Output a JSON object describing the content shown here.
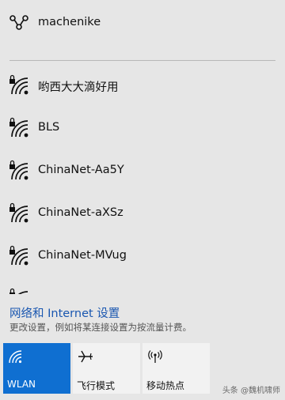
{
  "current": {
    "name": "machenike",
    "icon": "hotspot-link-icon"
  },
  "networks": [
    {
      "name": "哟西大大滴好用",
      "icon": "wifi-secured-icon"
    },
    {
      "name": "BLS",
      "icon": "wifi-secured-icon"
    },
    {
      "name": "ChinaNet-Aa5Y",
      "icon": "wifi-secured-icon"
    },
    {
      "name": "ChinaNet-aXSz",
      "icon": "wifi-secured-icon"
    },
    {
      "name": "ChinaNet-MVug",
      "icon": "wifi-secured-icon"
    }
  ],
  "settings": {
    "link": "网络和 Internet 设置",
    "desc": "更改设置，例如将某连接设置为按流量计费。"
  },
  "tiles": [
    {
      "label": "WLAN",
      "icon": "wifi-icon",
      "active": true
    },
    {
      "label": "飞行模式",
      "icon": "airplane-icon",
      "active": false
    },
    {
      "label": "移动热点",
      "icon": "mobile-hotspot-icon",
      "active": false
    }
  ],
  "watermark": "头条 @魏机啸师",
  "colors": {
    "accent": "#0f6fd1",
    "link": "#1a57b0",
    "panel": "#e6e6e6"
  }
}
